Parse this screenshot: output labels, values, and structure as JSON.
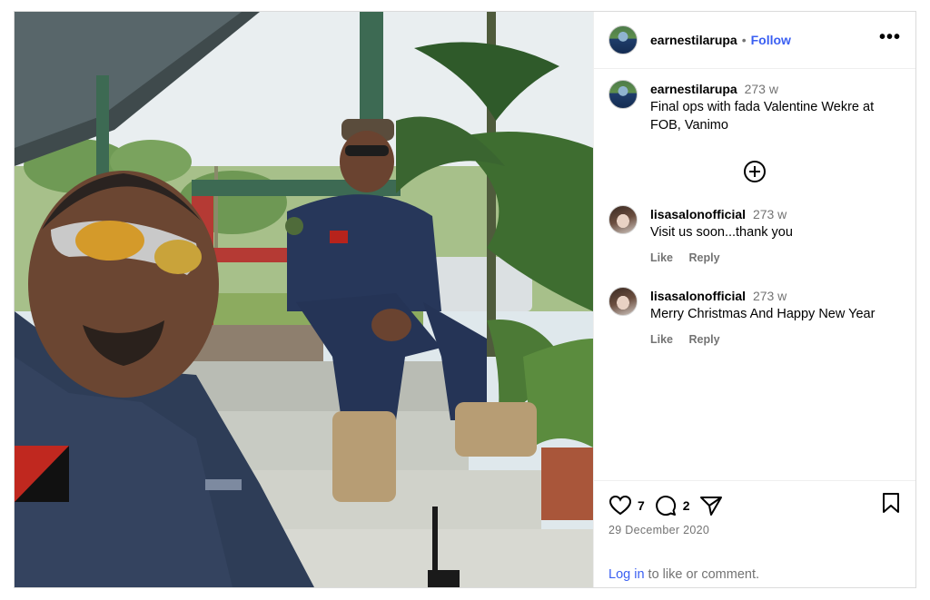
{
  "post": {
    "author": "earnestilarupa",
    "follow_label": "Follow",
    "dot": "•",
    "more_label": "•••",
    "caption_time": "273 w",
    "caption": "Final ops with fada Valentine Wekre at FOB, Vanimo",
    "likes": "7",
    "comment_count": "2",
    "date": "29 December 2020",
    "login_link": "Log in",
    "login_text": " to like or comment."
  },
  "comments": [
    {
      "user": "lisasalonofficial",
      "time": "273 w",
      "text": "Visit us soon...thank you",
      "like": "Like",
      "reply": "Reply"
    },
    {
      "user": "lisasalonofficial",
      "time": "273 w",
      "text": "Merry Christmas And Happy New Year",
      "like": "Like",
      "reply": "Reply"
    }
  ],
  "icons": {
    "load_more": "plus-circle-icon",
    "like": "heart-icon",
    "comment": "comment-icon",
    "share": "send-icon",
    "save": "bookmark-icon",
    "more": "more-options-icon"
  },
  "colors": {
    "link_blue": "#3a5ff2",
    "muted": "#737373",
    "border": "#dbdbdb"
  },
  "photo": {
    "alt": "Selfie of two men in navy uniforms sitting on concrete steps outside a building with palm trees"
  }
}
